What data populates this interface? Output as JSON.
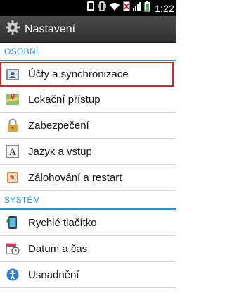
{
  "statusbar": {
    "time": "1:22",
    "icons": [
      "phone-icon",
      "vibrate-icon",
      "wifi-icon",
      "no-sim-icon",
      "signal-icon",
      "battery-icon"
    ]
  },
  "header": {
    "title": "Nastavení",
    "icon": "settings-gear-icon"
  },
  "sections": [
    {
      "title": "OSOBNÍ",
      "items": [
        {
          "label": "Účty a synchronizace",
          "icon": "accounts-icon",
          "selected": true
        },
        {
          "label": "Lokační přístup",
          "icon": "map-location-icon"
        },
        {
          "label": "Zabezpečení",
          "icon": "lock-icon"
        },
        {
          "label": "Jazyk a vstup",
          "icon": "language-icon"
        },
        {
          "label": "Zálohování a restart",
          "icon": "backup-icon"
        }
      ]
    },
    {
      "title": "SYSTÉM",
      "items": [
        {
          "label": "Rychlé tlačítko",
          "icon": "quick-button-icon"
        },
        {
          "label": "Datum a čas",
          "icon": "calendar-clock-icon"
        },
        {
          "label": "Usnadnění",
          "icon": "accessibility-icon"
        }
      ]
    }
  ],
  "colors": {
    "accent": "#1e95d8",
    "selection_outline": "#e0201f"
  }
}
